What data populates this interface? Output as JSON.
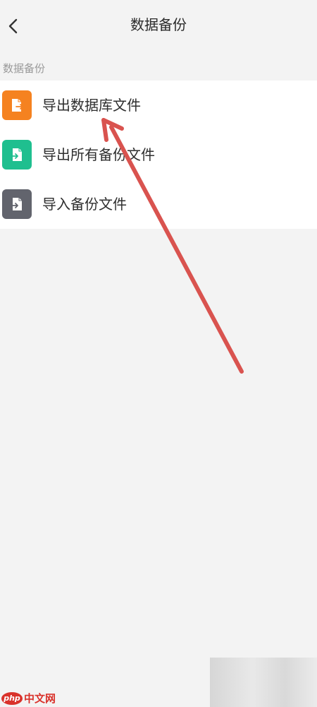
{
  "header": {
    "title": "数据备份",
    "back_icon": "chevron-left-icon"
  },
  "section": {
    "label": "数据备份"
  },
  "menu": {
    "items": [
      {
        "label": "导出数据库文件",
        "icon": "file-export-icon",
        "color": "#f58220"
      },
      {
        "label": "导出所有备份文件",
        "icon": "file-import-icon",
        "color": "#1fbf8f"
      },
      {
        "label": "导入备份文件",
        "icon": "file-import-icon",
        "color": "#62646d"
      }
    ]
  },
  "annotation": {
    "color": "#d9534f"
  },
  "watermark": {
    "logo_text": "php",
    "site_text": "中文网"
  }
}
